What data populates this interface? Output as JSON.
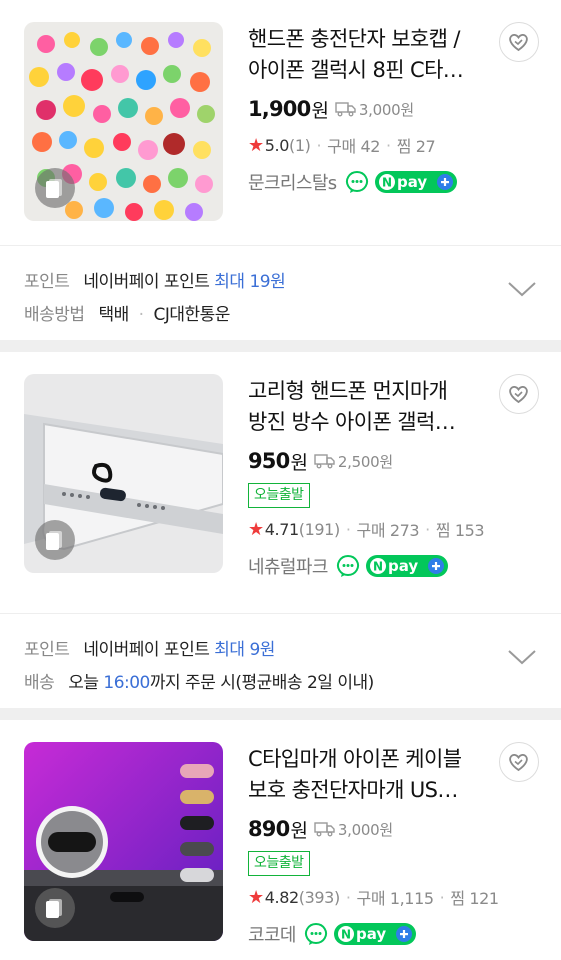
{
  "products": [
    {
      "title_line1": "핸드폰 충전단자 보호캡 /",
      "title_line2": "아이폰 갤럭시 8핀 C타…",
      "price": "1,900",
      "price_unit": "원",
      "shipping_fee": "3,000원",
      "badge": "",
      "rating": "5.0",
      "review_count": "(1)",
      "purchase": "구매 42",
      "zzim": "찜 27",
      "seller": "문크리스탈s",
      "thumb_icon": "jelly-bear-charms-image"
    },
    {
      "title_line1": "고리형 핸드폰 먼지마개",
      "title_line2": "방진 방수 아이폰 갤럭…",
      "price": "950",
      "price_unit": "원",
      "shipping_fee": "2,500원",
      "badge": "오늘출발",
      "rating": "4.71",
      "review_count": "(191)",
      "purchase": "구매 273",
      "zzim": "찜 153",
      "seller": "네츄럴파크",
      "thumb_icon": "phone-dust-plug-image"
    },
    {
      "title_line1": "C타입마개 아이폰 케이블",
      "title_line2": "보호 충전단자마개 US…",
      "price": "890",
      "price_unit": "원",
      "shipping_fee": "3,000원",
      "badge": "오늘출발",
      "rating": "4.82",
      "review_count": "(393)",
      "purchase": "구매 1,115",
      "zzim": "찜 121",
      "seller": "코코데",
      "thumb_icon": "usb-c-plugs-image"
    }
  ],
  "benefits": [
    {
      "point_label": "포인트",
      "point_text": "네이버페이 포인트",
      "point_max": "최대 19원",
      "ship_label": "배송방법",
      "ship_method": "택배",
      "ship_carrier": "CJ대한통운"
    },
    {
      "point_label": "포인트",
      "point_text": "네이버페이 포인트",
      "point_max": "최대 9원",
      "ship_label": "배송",
      "ship_pre": "오늘",
      "ship_time": "16:00",
      "ship_post": "까지 주문 시(평균배송 2일 이내)"
    }
  ],
  "npay_label": "pay",
  "colors": {
    "rating_star": "#ef3b3b",
    "badge_green": "#12b33a",
    "point_blue": "#3b6fd6",
    "npay_green": "#03c75a",
    "divider": "#efefef"
  }
}
